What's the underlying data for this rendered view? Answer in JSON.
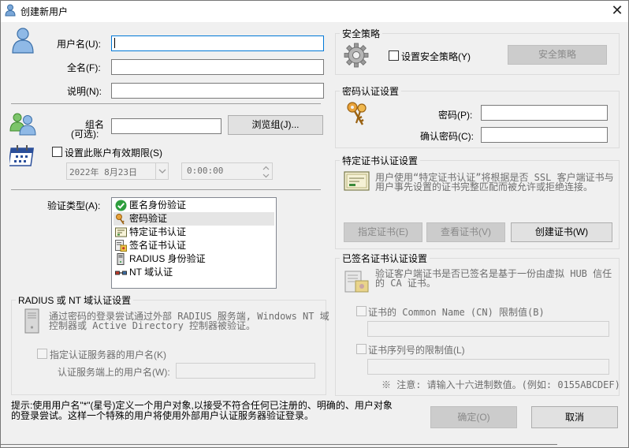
{
  "window": {
    "title": "创建新用户",
    "close": "✕"
  },
  "user": {
    "username_label": "用户名(U):",
    "fullname_label": "全名(F):",
    "description_label": "说明(N):",
    "username_value": "",
    "fullname_value": "",
    "description_value": ""
  },
  "group": {
    "label_line1": "组名",
    "label_line2": "(可选):",
    "value": "",
    "browse_button": "浏览组(J)..."
  },
  "expiry": {
    "checkbox_label": "设置此账户有效期限(S)",
    "checked": false,
    "date": "2022年 8月23日",
    "time": "0:00:00"
  },
  "auth_type": {
    "label": "验证类型(A):",
    "items": [
      {
        "label": "匿名身份验证",
        "icon": "check-circle-icon",
        "selected": false
      },
      {
        "label": "密码验证",
        "icon": "keys-icon",
        "selected": true
      },
      {
        "label": "特定证书认证",
        "icon": "certificate-icon",
        "selected": false
      },
      {
        "label": "签名证书认证",
        "icon": "signed-certificate-icon",
        "selected": false
      },
      {
        "label": "RADIUS 身份验证",
        "icon": "server-icon",
        "selected": false
      },
      {
        "label": "NT 域认证",
        "icon": "network-icon",
        "selected": false
      }
    ]
  },
  "radius": {
    "title": "RADIUS 或 NT 域认证设置",
    "desc_line1": "通过密码的登录尝试通过外部 RADIUS 服务端, Windows NT 域",
    "desc_line2": "控制器或 Active Directory 控制器被验证。",
    "specify_checkbox": "指定认证服务器的用户名(K)",
    "server_username_label": "认证服务端上的用户名(W):",
    "server_username_value": ""
  },
  "hint": {
    "line1": "提示:使用用户名\"*\"(星号)定义一个用户对象,以接受不符合任何已注册的、明确的、用户对象",
    "line2": "的登录尝试。这样一个特殊的用户将使用外部用户认证服务器验证登录。"
  },
  "security_policy": {
    "title": "安全策略",
    "checkbox": "设置安全策略(Y)",
    "checked": false,
    "button": "安全策略"
  },
  "password_auth": {
    "title": "密码认证设置",
    "password_label": "密码(P):",
    "confirm_label": "确认密码(C):",
    "password_value": "",
    "confirm_value": ""
  },
  "cert_auth": {
    "title": "特定证书认证设置",
    "desc_line1": "用户使用“特定证书认证”将根据是否 SSL 客户端证书与",
    "desc_line2": "用户事先设置的证书完整匹配而被允许或拒绝连接。",
    "specify_button": "指定证书(E)",
    "view_button": "查看证书(V)",
    "create_button": "创建证书(W)"
  },
  "signed_cert": {
    "title": "已签名证书认证设置",
    "desc_line1": "验证客户端证书是否已签名是基于一份由虚拟 HUB 信任",
    "desc_line2": "的 CA 证书。",
    "cn_checkbox": "证书的 Common Name (CN) 限制值(B)",
    "cn_value": "",
    "serial_checkbox": "证书序列号的限制值(L)",
    "serial_value": "",
    "note": "※ 注意: 请输入十六进制数值。(例如: 0155ABCDEF)"
  },
  "footer": {
    "ok_button": "确定(O)",
    "cancel_button": "取消"
  },
  "colors": {
    "window_bg": "#f0f0f0",
    "focus_border": "#0078d7",
    "disabled_text": "#6d6d6d"
  }
}
